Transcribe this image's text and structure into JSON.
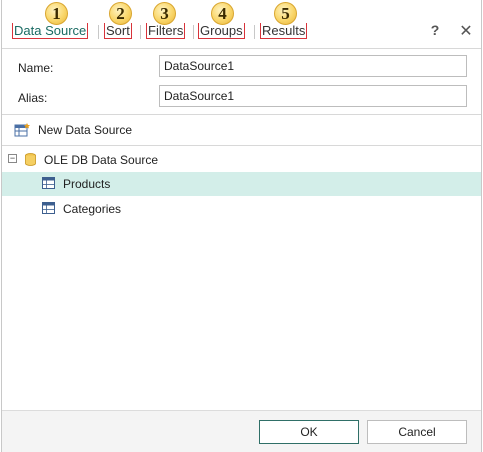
{
  "tabs": [
    {
      "number": "1",
      "label": "Data Source",
      "active": true
    },
    {
      "number": "2",
      "label": "Sort"
    },
    {
      "number": "3",
      "label": "Filters"
    },
    {
      "number": "4",
      "label": "Groups"
    },
    {
      "number": "5",
      "label": "Results"
    }
  ],
  "header": {
    "help": "?",
    "close": "✕"
  },
  "form": {
    "name_label": "Name:",
    "name_value": "DataSource1",
    "alias_label": "Alias:",
    "alias_value": "DataSource1"
  },
  "toolbar": {
    "new_data_source": "New Data Source"
  },
  "tree": {
    "root": {
      "label": "OLE DB Data Source",
      "expander": "−"
    },
    "children": [
      {
        "label": "Products",
        "selected": true
      },
      {
        "label": "Categories",
        "selected": false
      }
    ]
  },
  "footer": {
    "ok": "OK",
    "cancel": "Cancel"
  },
  "colors": {
    "accent": "#1a6b63",
    "selection": "#d3eee9",
    "badge": "#f9d66a",
    "annotation_box": "#d8333a"
  }
}
